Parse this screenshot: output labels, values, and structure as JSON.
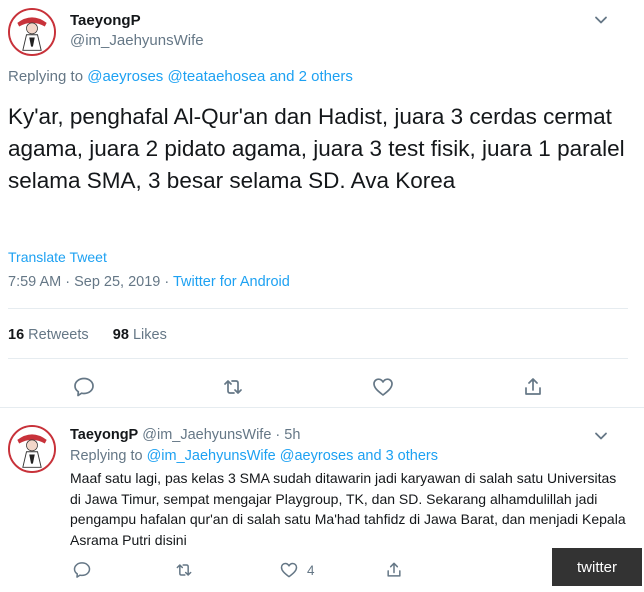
{
  "main_tweet": {
    "display_name": "TaeyongP",
    "handle": "@im_JaehyunsWife",
    "replying_prefix": "Replying to",
    "replying_mention_1": "@aeyroses",
    "replying_mention_2": "@teataehosea",
    "replying_others": "and 2 others",
    "text": "Ky'ar,  penghafal Al-Qur'an dan Hadist, juara 3 cerdas cermat agama, juara 2 pidato agama, juara 3 test fisik, juara 1 paralel selama SMA, 3 besar selama SD. Ava Korea",
    "translate_label": "Translate Tweet",
    "timestamp": "7:59 AM · Sep 25, 2019 · ",
    "source": "Twitter for Android",
    "retweets_count": "16",
    "retweets_label": "Retweets",
    "likes_count": "98",
    "likes_label": "Likes"
  },
  "reply_tweet": {
    "display_name": "TaeyongP",
    "handle_time": "@im_JaehyunsWife · 5h",
    "replying_prefix": "Replying to",
    "replying_mentions": "@im_JaehyunsWife @aeyroses and 3 others",
    "text": "Maaf satu lagi, pas kelas 3 SMA sudah ditawarin jadi karyawan di salah satu Universitas di Jawa Timur, sempat mengajar Playgroup, TK, dan SD. Sekarang alhamdulillah jadi pengampu hafalan qur'an di salah satu Ma'had tahfidz di Jawa Barat, dan menjadi Kepala Asrama Putri disini",
    "like_count": "4"
  },
  "watermark": "twitter",
  "icons": {
    "reply": "speech-bubble-icon",
    "retweet": "retweet-icon",
    "like": "heart-icon",
    "share": "share-icon",
    "more": "chevron-down-icon"
  },
  "colors": {
    "accent": "#1da1f2",
    "muted": "#657786",
    "text": "#14171a"
  }
}
